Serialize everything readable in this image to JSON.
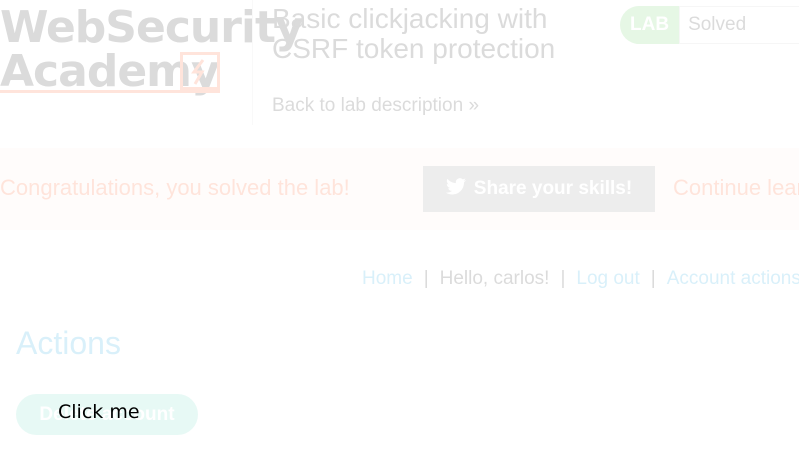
{
  "logo": {
    "line1": "WebSecurity",
    "line2": "Academy"
  },
  "lab": {
    "title": "Basic clickjacking with CSRF token protection",
    "back_link": "Back to lab description",
    "badge_tag": "LAB",
    "badge_status": "Solved"
  },
  "banner": {
    "message": "Congratulations, you solved the lab!",
    "share_button": "Share your skills!",
    "continue_link": "Continue learning"
  },
  "nav": {
    "home": "Home",
    "greeting": "Hello, carlos!",
    "logout": "Log out",
    "account": "Account actions",
    "separator": "|"
  },
  "actions": {
    "heading": "Actions",
    "delete_button": "Delete account"
  },
  "decoy": {
    "label": "Click me"
  },
  "colors": {
    "accent_orange": "#ff6633",
    "link_blue": "#29abe0",
    "teal": "#79dbc7",
    "green": "#70d16d"
  },
  "icons": {
    "share": "twitter-icon",
    "back": "double-chevron-right-icon",
    "logo": "lightning-bolt-icon"
  }
}
